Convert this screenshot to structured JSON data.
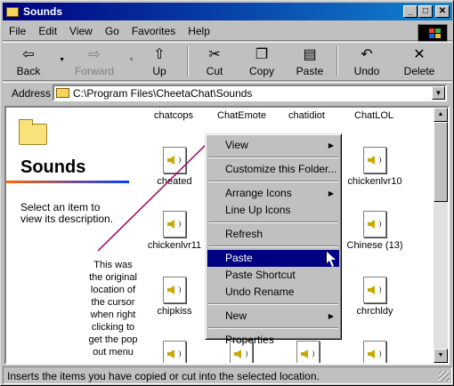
{
  "window": {
    "title": "Sounds",
    "buttons": {
      "minimize": "_",
      "maximize": "□",
      "close": "✕"
    }
  },
  "menubar": [
    "File",
    "Edit",
    "View",
    "Go",
    "Favorites",
    "Help"
  ],
  "toolbar": {
    "back": "Back",
    "forward": "Forward",
    "up": "Up",
    "cut": "Cut",
    "copy": "Copy",
    "paste": "Paste",
    "undo": "Undo",
    "delete": "Delete"
  },
  "address": {
    "label": "Address",
    "value": "C:\\Program Files\\CheetaChat\\Sounds"
  },
  "left_pane": {
    "title": "Sounds",
    "description": "Select an item to view its description."
  },
  "header_row": [
    "chatcops",
    "ChatEmote",
    "chatidiot",
    "ChatLOL"
  ],
  "files": [
    {
      "name": "cheated"
    },
    {
      "name": "chickenlvr10"
    },
    {
      "name": "chickenlvr11"
    },
    {
      "name": "Chinese (13)"
    },
    {
      "name": "chipkiss"
    },
    {
      "name": "chrchldy"
    }
  ],
  "annotation": "This was the original location of the cursor when right clicking to get the pop out menu",
  "context_menu": {
    "items": [
      {
        "label": "View",
        "submenu": true
      },
      {
        "sep": true
      },
      {
        "label": "Customize this Folder..."
      },
      {
        "sep": true
      },
      {
        "label": "Arrange Icons",
        "submenu": true
      },
      {
        "label": "Line Up Icons"
      },
      {
        "sep": true
      },
      {
        "label": "Refresh"
      },
      {
        "sep": true
      },
      {
        "label": "Paste",
        "selected": true
      },
      {
        "label": "Paste Shortcut"
      },
      {
        "label": "Undo Rename"
      },
      {
        "sep": true
      },
      {
        "label": "New",
        "submenu": true
      },
      {
        "sep": true
      },
      {
        "label": "Properties"
      }
    ]
  },
  "status": "Inserts the items you have copied or cut into the selected location.",
  "colors": {
    "title_start": "#000080",
    "title_end": "#1084d0",
    "selection": "#000080",
    "annotation_arrow": "#a0005a"
  }
}
